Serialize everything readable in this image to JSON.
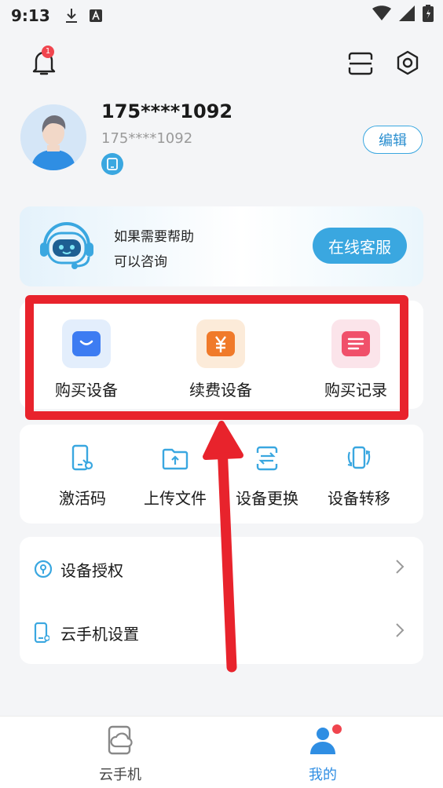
{
  "status_bar": {
    "time": "9:13"
  },
  "header": {
    "notification_count": "1"
  },
  "profile": {
    "name": "175****1092",
    "sub": "175****1092",
    "edit_label": "编辑"
  },
  "help": {
    "line1": "如果需要帮助",
    "line2": "可以咨询",
    "button_label": "在线客服"
  },
  "purchase": {
    "items": [
      {
        "label": "购买设备",
        "icon": "shopping-bag-icon",
        "color": "#3d7cf2",
        "bg": "#e3eefc"
      },
      {
        "label": "续费设备",
        "icon": "yuan-icon",
        "color": "#f07a2a",
        "bg": "#fcebd9"
      },
      {
        "label": "购买记录",
        "icon": "list-icon",
        "color": "#f0506a",
        "bg": "#fbe4ea"
      }
    ]
  },
  "tools": {
    "items": [
      {
        "label": "激活码",
        "icon": "phone-key-icon"
      },
      {
        "label": "上传文件",
        "icon": "upload-folder-icon"
      },
      {
        "label": "设备更换",
        "icon": "swap-icon"
      },
      {
        "label": "设备转移",
        "icon": "transfer-phone-icon"
      }
    ]
  },
  "settings_list": {
    "items": [
      {
        "label": "设备授权",
        "icon": "lock-icon"
      },
      {
        "label": "云手机设置",
        "icon": "phone-settings-icon"
      }
    ]
  },
  "tabbar": {
    "tabs": [
      {
        "label": "云手机",
        "active": false
      },
      {
        "label": "我的",
        "active": true
      }
    ]
  },
  "colors": {
    "accent": "#3aa7e0",
    "highlight": "#e8232c",
    "badge": "#f0454e"
  }
}
